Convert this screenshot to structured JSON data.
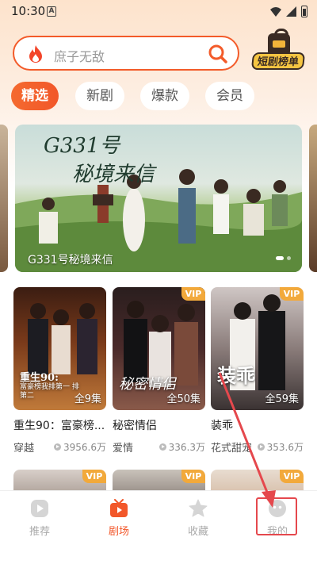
{
  "status_bar": {
    "time": "10:30",
    "app_indicator": "A"
  },
  "search": {
    "placeholder": "庶子无敌",
    "left_icon": "fire-icon",
    "right_icon": "search-icon"
  },
  "drama_rank": {
    "label": "短剧榜单"
  },
  "tabs": [
    {
      "label": "精选",
      "active": true
    },
    {
      "label": "新剧",
      "active": false
    },
    {
      "label": "爆款",
      "active": false
    },
    {
      "label": "会员",
      "active": false
    }
  ],
  "banner": {
    "art_line1": "G331号",
    "art_line2": "秘境来信",
    "caption": "G331号秘境来信"
  },
  "cards": [
    {
      "title": "重生90：富豪榜...",
      "genre": "穿越",
      "views": "3956.6万",
      "episodes": "全9集",
      "vip": false,
      "art_top": "重生90:",
      "art_bottom": "富豪榜我排第一 排第二"
    },
    {
      "title": "秘密情侣",
      "genre": "爱情",
      "views": "336.3万",
      "episodes": "全50集",
      "vip": true,
      "vip_label": "VIP",
      "art_top": "秘密情侣"
    },
    {
      "title": "装乖",
      "genre": "花式甜宠",
      "views": "353.6万",
      "episodes": "全59集",
      "vip": true,
      "vip_label": "VIP",
      "art_top": "装乖"
    }
  ],
  "row2": [
    {
      "vip": true,
      "vip_label": "VIP"
    },
    {
      "vip": true,
      "vip_label": "VIP"
    },
    {
      "vip": true,
      "vip_label": "VIP"
    }
  ],
  "bottom_nav": [
    {
      "label": "推荐",
      "icon": "play-circle-icon",
      "active": false
    },
    {
      "label": "剧场",
      "icon": "tv-icon",
      "active": true
    },
    {
      "label": "收藏",
      "icon": "star-icon",
      "active": false
    },
    {
      "label": "我的",
      "icon": "profile-icon",
      "active": false
    }
  ],
  "colors": {
    "accent": "#f2572a",
    "vip": "#f2a93b",
    "annotation": "#e5484d"
  }
}
